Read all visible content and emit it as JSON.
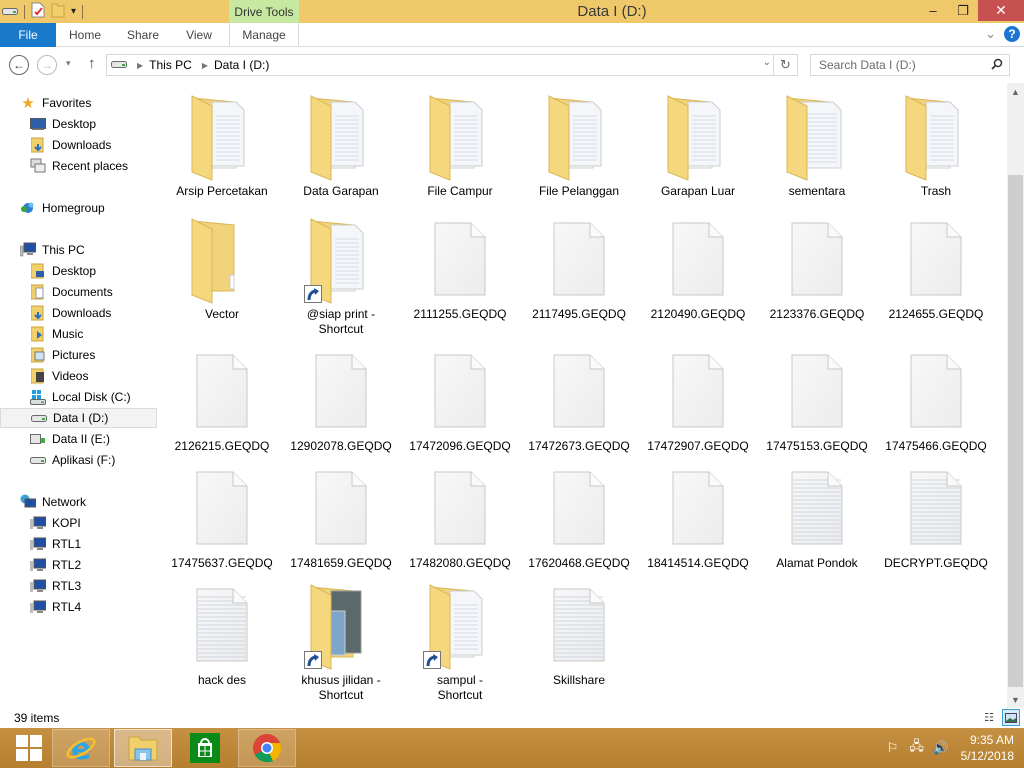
{
  "window": {
    "title": "Data I (D:)",
    "contextual_tab_group": "Drive Tools",
    "controls": {
      "minimize": "–",
      "maximize": "❐",
      "close": "✕"
    }
  },
  "quick_access_toolbar": {
    "icons": [
      "drive-icon",
      "properties-icon",
      "new-folder-icon",
      "customize-dropdown-icon"
    ],
    "dropdown_glyph": "▾"
  },
  "ribbon": {
    "tabs": [
      {
        "label": "File"
      },
      {
        "label": "Home"
      },
      {
        "label": "Share"
      },
      {
        "label": "View"
      },
      {
        "label": "Manage"
      }
    ],
    "expand_glyph": "⌄",
    "help_glyph": "?"
  },
  "navigation": {
    "back_glyph": "←",
    "forward_glyph": "→",
    "recent_glyph": "▾",
    "up_glyph": "↑",
    "breadcrumb": [
      "This PC",
      "Data I (D:)"
    ],
    "breadcrumb_sep": "▶",
    "dropdown_glyph": "⌄",
    "refresh_glyph": "↻",
    "search_placeholder": "Search Data I (D:)",
    "search_glyph": "⚲"
  },
  "sidebar": {
    "groups": [
      {
        "label": "Favorites",
        "icon": "star-icon",
        "items": [
          {
            "label": "Desktop",
            "icon": "desktop-icon"
          },
          {
            "label": "Downloads",
            "icon": "downloads-folder-icon"
          },
          {
            "label": "Recent places",
            "icon": "recent-places-icon"
          }
        ]
      },
      {
        "label": "Homegroup",
        "icon": "homegroup-icon",
        "items": []
      },
      {
        "label": "This PC",
        "icon": "computer-icon",
        "items": [
          {
            "label": "Desktop",
            "icon": "desktop-folder-icon"
          },
          {
            "label": "Documents",
            "icon": "documents-folder-icon"
          },
          {
            "label": "Downloads",
            "icon": "downloads-folder-icon"
          },
          {
            "label": "Music",
            "icon": "music-folder-icon"
          },
          {
            "label": "Pictures",
            "icon": "pictures-folder-icon"
          },
          {
            "label": "Videos",
            "icon": "videos-folder-icon"
          },
          {
            "label": "Local Disk (C:)",
            "icon": "windows-drive-icon"
          },
          {
            "label": "Data I (D:)",
            "icon": "drive-icon",
            "selected": true
          },
          {
            "label": "Data II (E:)",
            "icon": "drive-icon"
          },
          {
            "label": "Aplikasi (F:)",
            "icon": "drive-icon"
          }
        ]
      },
      {
        "label": "Network",
        "icon": "network-icon",
        "items": [
          {
            "label": "KOPI",
            "icon": "network-computer-icon"
          },
          {
            "label": "RTL1",
            "icon": "network-computer-icon"
          },
          {
            "label": "RTL2",
            "icon": "network-computer-icon"
          },
          {
            "label": "RTL3",
            "icon": "network-computer-icon"
          },
          {
            "label": "RTL4",
            "icon": "network-computer-icon"
          }
        ]
      }
    ]
  },
  "files": [
    {
      "name": "Arsip Percetakan",
      "type": "folder-docs"
    },
    {
      "name": "Data Garapan",
      "type": "folder-docs"
    },
    {
      "name": "File Campur",
      "type": "folder-docs"
    },
    {
      "name": "File Pelanggan",
      "type": "folder-docs"
    },
    {
      "name": "Garapan Luar",
      "type": "folder-docs"
    },
    {
      "name": "sementara",
      "type": "folder-doc"
    },
    {
      "name": "Trash",
      "type": "folder-docs"
    },
    {
      "name": "Vector",
      "type": "folder-empty"
    },
    {
      "name": "@siap print - Shortcut",
      "type": "folder-docs",
      "shortcut": true
    },
    {
      "name": "2111255.GEQDQ",
      "type": "file-blank"
    },
    {
      "name": "2117495.GEQDQ",
      "type": "file-blank"
    },
    {
      "name": "2120490.GEQDQ",
      "type": "file-blank"
    },
    {
      "name": "2123376.GEQDQ",
      "type": "file-blank"
    },
    {
      "name": "2124655.GEQDQ",
      "type": "file-blank"
    },
    {
      "name": "2126215.GEQDQ",
      "type": "file-blank"
    },
    {
      "name": "12902078.GEQDQ",
      "type": "file-blank"
    },
    {
      "name": "17472096.GEQDQ",
      "type": "file-blank"
    },
    {
      "name": "17472673.GEQDQ",
      "type": "file-blank"
    },
    {
      "name": "17472907.GEQDQ",
      "type": "file-blank"
    },
    {
      "name": "17475153.GEQDQ",
      "type": "file-blank"
    },
    {
      "name": "17475466.GEQDQ",
      "type": "file-blank"
    },
    {
      "name": "17475637.GEQDQ",
      "type": "file-blank"
    },
    {
      "name": "17481659.GEQDQ",
      "type": "file-blank"
    },
    {
      "name": "17482080.GEQDQ",
      "type": "file-blank"
    },
    {
      "name": "17620468.GEQDQ",
      "type": "file-blank"
    },
    {
      "name": "18414514.GEQDQ",
      "type": "file-blank"
    },
    {
      "name": "Alamat Pondok",
      "type": "file-text"
    },
    {
      "name": "DECRYPT.GEQDQ",
      "type": "file-text"
    },
    {
      "name": "hack des",
      "type": "file-text"
    },
    {
      "name": "khusus jilidan - Shortcut",
      "type": "folder-pics",
      "shortcut": true
    },
    {
      "name": "sampul - Shortcut",
      "type": "folder-docs",
      "shortcut": true
    },
    {
      "name": "Skillshare",
      "type": "file-text"
    }
  ],
  "status": {
    "item_count": "39 items",
    "view_details_glyph": "☷",
    "view_large_glyph": "▣"
  },
  "scrollbar": {
    "up_glyph": "▲",
    "down_glyph": "▼",
    "position_fraction": 0.15
  },
  "taskbar": {
    "apps": [
      {
        "name": "start",
        "icon": "windows-start-icon"
      },
      {
        "name": "Internet Explorer",
        "icon": "internet-explorer-icon"
      },
      {
        "name": "File Explorer",
        "icon": "file-explorer-icon",
        "active": true
      },
      {
        "name": "Store",
        "icon": "windows-store-icon"
      },
      {
        "name": "Google Chrome",
        "icon": "chrome-icon"
      }
    ],
    "tray": {
      "icons": [
        "action-center-flag-icon",
        "network-icon",
        "volume-icon"
      ],
      "time": "9:35 AM",
      "date": "5/12/2018"
    }
  },
  "colors": {
    "titlebar": "#efc86a",
    "file_tab": "#1979ca",
    "drive_tools": "#c6e8a0",
    "close_button": "#c75050",
    "taskbar": "#be8a3a",
    "folder": "#f5d77e"
  }
}
